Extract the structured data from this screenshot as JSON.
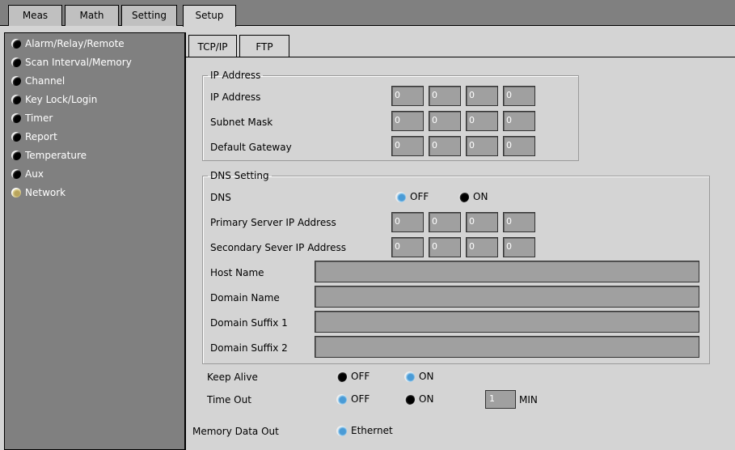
{
  "top_tabs": [
    "Meas",
    "Math",
    "Setting",
    "Setup"
  ],
  "sidebar": {
    "items": [
      {
        "label": "Alarm/Relay/Remote"
      },
      {
        "label": "Scan Interval/Memory"
      },
      {
        "label": "Channel"
      },
      {
        "label": "Key Lock/Login"
      },
      {
        "label": "Timer"
      },
      {
        "label": "Report"
      },
      {
        "label": "Temperature"
      },
      {
        "label": "Aux"
      },
      {
        "label": "Network"
      }
    ]
  },
  "inner_tabs": [
    "TCP/IP",
    "FTP"
  ],
  "ip_section": {
    "legend": "IP Address",
    "rows": [
      {
        "label": "IP Address",
        "values": [
          "0",
          "0",
          "0",
          "0"
        ]
      },
      {
        "label": "Subnet Mask",
        "values": [
          "0",
          "0",
          "0",
          "0"
        ]
      },
      {
        "label": "Default Gateway",
        "values": [
          "0",
          "0",
          "0",
          "0"
        ]
      }
    ]
  },
  "dns_section": {
    "legend": "DNS Setting",
    "dns_label": "DNS",
    "dns_off": "OFF",
    "dns_on": "ON",
    "primary_label": "Primary Server IP Address",
    "primary_values": [
      "0",
      "0",
      "0",
      "0"
    ],
    "secondary_label": "Secondary Sever IP Address",
    "secondary_values": [
      "0",
      "0",
      "0",
      "0"
    ],
    "host_name_label": "Host Name",
    "host_name_value": "",
    "domain_name_label": "Domain Name",
    "domain_name_value": "",
    "suffix1_label": "Domain Suffix 1",
    "suffix1_value": "",
    "suffix2_label": "Domain Suffix 2",
    "suffix2_value": ""
  },
  "keep_alive": {
    "label": "Keep Alive",
    "off": "OFF",
    "on": "ON"
  },
  "time_out": {
    "label": "Time Out",
    "off": "OFF",
    "on": "ON",
    "value": "1",
    "unit": "MIN"
  },
  "memory_data_out": {
    "label": "Memory Data Out",
    "option": "Ethernet"
  }
}
